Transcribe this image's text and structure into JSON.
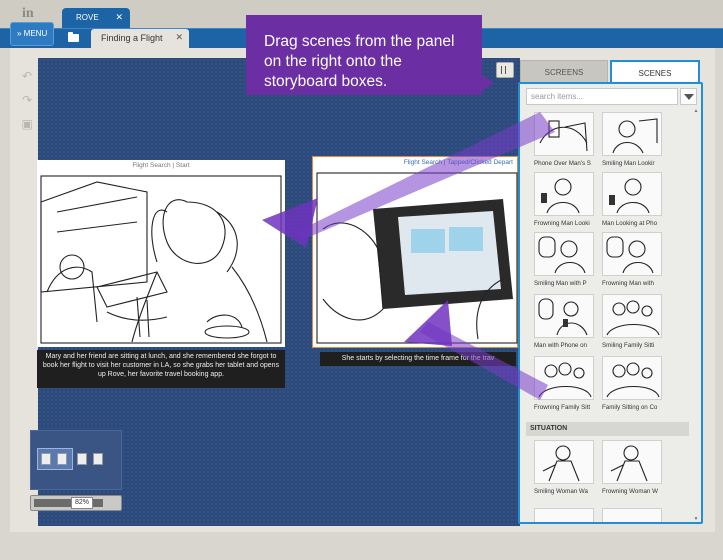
{
  "app": {
    "logo": "in"
  },
  "project_tab": {
    "label": "ROVE",
    "close": "✕"
  },
  "nav": {
    "menu_label": "» MENU",
    "doc_tab_label": "Finding a Flight",
    "doc_tab_close": "✕"
  },
  "toolbar": {
    "undo_icon": "undo-icon",
    "redo_icon": "redo-icon",
    "save_icon": "save-icon"
  },
  "storyboard": [
    {
      "header": "Flight Search  |  Start",
      "caption": "Mary and her friend are sitting at lunch, and she remembered she forgot to book her flight to visit her customer in LA, so she grabs her tablet and opens up Rove, her favorite travel booking app."
    },
    {
      "header": "Flight Search  |  Tapped/Clicked Depart",
      "caption": "She starts by selecting the time frame for the trav"
    }
  ],
  "panel": {
    "tabs": [
      "SCREENS",
      "SCENES"
    ],
    "active_tab": "SCENES",
    "search_placeholder": "search items...",
    "scenes": [
      "Phone Over Man's S",
      "Smiling Man Lookir",
      "Frowning Man Looki",
      "Man Looking at Pho",
      "Smiling Man with P",
      "Frowning Man with",
      "Man with Phone on",
      "Smiling Family Sitti",
      "Frowning Family Sitt",
      "Family Sitting on Co"
    ],
    "section_label": "SITUATION",
    "situation_scenes": [
      "Smiling Woman Wa",
      "Frowning Woman W"
    ]
  },
  "zoom": {
    "label": "82%",
    "value_percent": 82
  },
  "callout": {
    "text": "Drag scenes from the panel on the right onto the storyboard boxes."
  },
  "colors": {
    "nav_blue": "#1d64a6",
    "callout_purple": "#6b2fa3",
    "panel_border": "#1f8fd6",
    "canvas": "#2d4a7c"
  }
}
